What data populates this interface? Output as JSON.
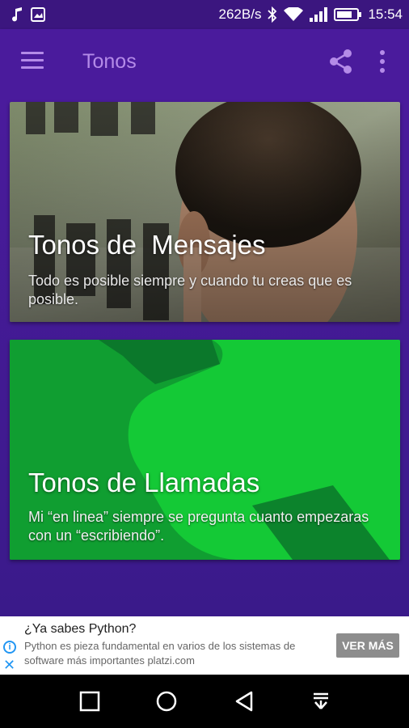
{
  "status_bar": {
    "icons_left": [
      "music-note-icon",
      "image-icon"
    ],
    "speed": "262B/s",
    "icons_right": [
      "bluetooth-icon",
      "wifi-icon",
      "signal-icon",
      "battery-icon"
    ],
    "time": "15:54"
  },
  "app_bar": {
    "title": "Tonos",
    "menu_icon": "menu-icon",
    "share_icon": "share-icon",
    "more_icon": "more-vert-icon"
  },
  "cards": [
    {
      "title": "Tonos de  Mensajes",
      "description": "Todo es posible siempre y cuando tu creas que es posible."
    },
    {
      "title": "Tonos de Llamadas",
      "description": "Mi “en linea” siempre se pregunta cuanto empezaras con un “escribiendo”."
    }
  ],
  "ad": {
    "title": "¿Ya sabes Python?",
    "body": "Python es pieza fundamental en varios de los sistemas de software más importantes platzi.com",
    "button": "VER MÁS",
    "info_glyph": "i",
    "close_glyph": "✕"
  },
  "nav_bar": {
    "buttons": [
      "square-icon",
      "circle-icon",
      "triangle-back-icon",
      "notification-down-icon"
    ]
  },
  "colors": {
    "status_bar": "#3b167f",
    "app_bar": "#4a1b9c",
    "title_accent": "#b48be8",
    "card2_green": "#12c532",
    "ad_button": "#8d8d8d"
  }
}
